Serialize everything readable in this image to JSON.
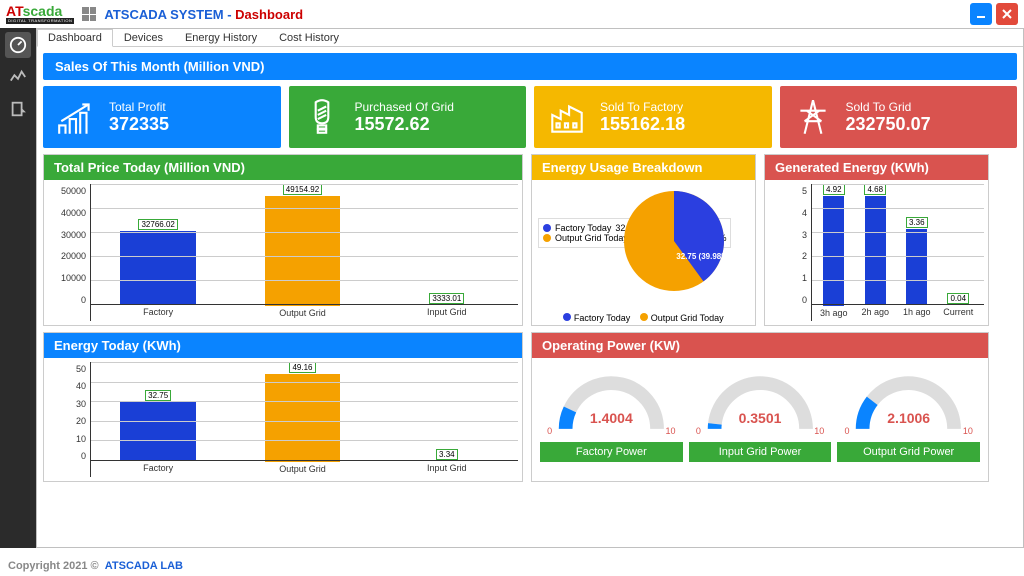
{
  "header": {
    "logo_top": "ATscada",
    "logo_bot": "DIGITAL TRANSFORMATION",
    "system": "ATSCADA SYSTEM -",
    "page": "Dashboard"
  },
  "tabs": [
    "Dashboard",
    "Devices",
    "Energy History",
    "Cost History"
  ],
  "sales_header": "Sales Of This Month (Million VND)",
  "kpi": [
    {
      "title": "Total Profit",
      "value": "372335",
      "color": "bg-blue",
      "icon": "chart"
    },
    {
      "title": "Purchased Of Grid",
      "value": "15572.62",
      "color": "bg-green",
      "icon": "bulb"
    },
    {
      "title": "Sold To Factory",
      "value": "155162.18",
      "color": "bg-yellow",
      "icon": "factory"
    },
    {
      "title": "Sold To Grid",
      "value": "232750.07",
      "color": "bg-red",
      "icon": "tower"
    }
  ],
  "price_today": {
    "title": "Total Price Today (Million VND)",
    "ymax": 50000,
    "yticks": [
      "50000",
      "40000",
      "30000",
      "20000",
      "10000",
      "0"
    ],
    "bars": [
      {
        "cat": "Factory",
        "val": 32766.02,
        "label": "32766.02",
        "color": "#1a3fd6"
      },
      {
        "cat": "Output Grid",
        "val": 49154.92,
        "label": "49154.92",
        "color": "#f5a100"
      },
      {
        "cat": "Input Grid",
        "val": 3333.01,
        "label": "3333.01",
        "color": "#e24a3b"
      }
    ]
  },
  "pie": {
    "title": "Energy Usage Breakdown",
    "legend": [
      {
        "name": "Factory Today",
        "txt": "32.75 (39.98%) 39.98%",
        "color": "#2b3fe0"
      },
      {
        "name": "Output Grid Today",
        "txt": "49.16 (60.02%) 60.02%",
        "color": "#f5a100"
      }
    ],
    "slice_label": "32.75 (39.98%)",
    "bottom": [
      {
        "dot": "#2b3fe0",
        "txt": "Factory Today"
      },
      {
        "dot": "#f5a100",
        "txt": "Output Grid Today"
      }
    ]
  },
  "gen": {
    "title": "Generated Energy (KWh)",
    "ymax": 5,
    "yticks": [
      "5",
      "4",
      "3",
      "2",
      "1",
      "0"
    ],
    "bars": [
      {
        "cat": "3h ago",
        "val": 4.92,
        "label": "4.92",
        "color": "#1a3fd6"
      },
      {
        "cat": "2h ago",
        "val": 4.68,
        "label": "4.68",
        "color": "#1a3fd6"
      },
      {
        "cat": "1h ago",
        "val": 3.36,
        "label": "3.36",
        "color": "#1a3fd6"
      },
      {
        "cat": "Current",
        "val": 0.04,
        "label": "0.04",
        "color": "#1a3fd6"
      }
    ]
  },
  "energy_today": {
    "title": "Energy Today (KWh)",
    "ymax": 50,
    "yticks": [
      "50",
      "40",
      "30",
      "20",
      "10",
      "0"
    ],
    "bars": [
      {
        "cat": "Factory",
        "val": 32.75,
        "label": "32.75",
        "color": "#1a3fd6"
      },
      {
        "cat": "Output Grid",
        "val": 49.16,
        "label": "49.16",
        "color": "#f5a100"
      },
      {
        "cat": "Input Grid",
        "val": 3.34,
        "label": "3.34",
        "color": "#e24a3b"
      }
    ]
  },
  "operating": {
    "title": "Operating Power (KW)",
    "min": "0",
    "max": "10",
    "gauges": [
      {
        "label": "Factory Power",
        "value": "1.4004",
        "frac": 0.14
      },
      {
        "label": "Input Grid Power",
        "value": "0.3501",
        "frac": 0.035
      },
      {
        "label": "Output Grid Power",
        "value": "2.1006",
        "frac": 0.21
      }
    ]
  },
  "footer": {
    "pre": "Copyright 2021 ©",
    "lab": "ATSCADA LAB"
  },
  "chart_data": [
    {
      "type": "bar",
      "title": "Total Price Today (Million VND)",
      "categories": [
        "Factory",
        "Output Grid",
        "Input Grid"
      ],
      "values": [
        32766.02,
        49154.92,
        3333.01
      ],
      "ylim": [
        0,
        50000
      ]
    },
    {
      "type": "pie",
      "title": "Energy Usage Breakdown",
      "series": [
        {
          "name": "Factory Today",
          "value": 32.75,
          "pct": 39.98
        },
        {
          "name": "Output Grid Today",
          "value": 49.16,
          "pct": 60.02
        }
      ]
    },
    {
      "type": "bar",
      "title": "Generated Energy (KWh)",
      "categories": [
        "3h ago",
        "2h ago",
        "1h ago",
        "Current"
      ],
      "values": [
        4.92,
        4.68,
        3.36,
        0.04
      ],
      "ylim": [
        0,
        5
      ]
    },
    {
      "type": "bar",
      "title": "Energy Today (KWh)",
      "categories": [
        "Factory",
        "Output Grid",
        "Input Grid"
      ],
      "values": [
        32.75,
        49.16,
        3.34
      ],
      "ylim": [
        0,
        50
      ]
    },
    {
      "type": "gauge",
      "title": "Operating Power (KW)",
      "series": [
        {
          "name": "Factory Power",
          "value": 1.4004,
          "range": [
            0,
            10
          ]
        },
        {
          "name": "Input Grid Power",
          "value": 0.3501,
          "range": [
            0,
            10
          ]
        },
        {
          "name": "Output Grid Power",
          "value": 2.1006,
          "range": [
            0,
            10
          ]
        }
      ]
    }
  ]
}
